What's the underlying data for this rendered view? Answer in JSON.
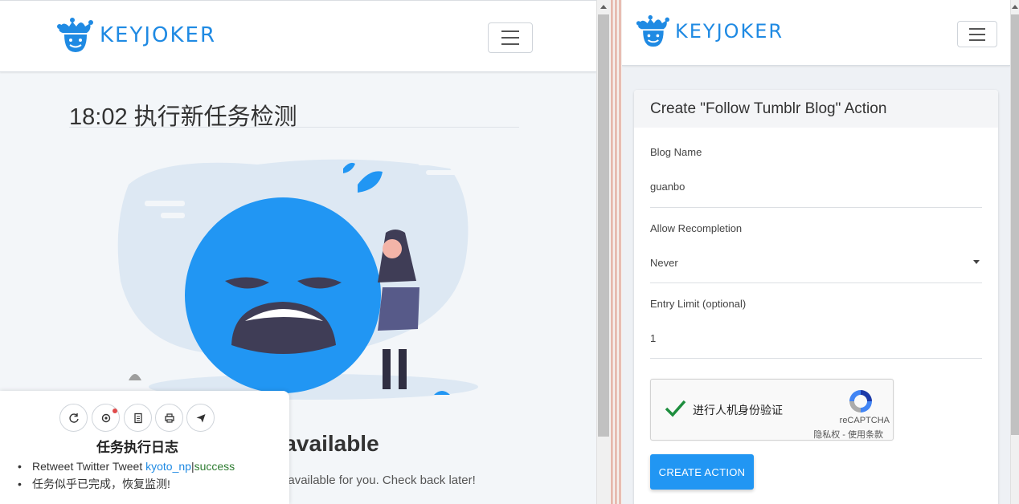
{
  "left_panel": {
    "brand": "KEYJOKER",
    "heading": "18:02 执行新任务检测",
    "empty_title": "s available",
    "empty_subtitle": "ons available for you. Check back later!",
    "task_log": {
      "title": "任务执行日志",
      "toolbar": [
        "refresh-icon",
        "gear-icon",
        "document-icon",
        "printer-icon",
        "send-icon"
      ],
      "entries": [
        {
          "text": "Retweet Twitter Tweet ",
          "link": "kyoto_np",
          "separator": "|",
          "status": "success"
        },
        {
          "text": "任务似乎已完成，恢复监测!"
        }
      ]
    }
  },
  "right_panel": {
    "brand": "KEYJOKER",
    "card_title": "Create \"Follow Tumblr Blog\" Action",
    "fields": {
      "blog_name": {
        "label": "Blog Name",
        "value": "guanbo"
      },
      "allow_recompletion": {
        "label": "Allow Recompletion",
        "value": "Never"
      },
      "entry_limit": {
        "label": "Entry Limit (optional)",
        "value": "1"
      }
    },
    "recaptcha": {
      "label": "进行人机身份验证",
      "brand": "reCAPTCHA",
      "links": "隐私权 - 使用条款"
    },
    "create_button": "CREATE ACTION"
  },
  "colors": {
    "brand_blue": "#1f8ae3",
    "button_blue": "#2196f3",
    "success_green": "#2f7d32",
    "check_green": "#1e8e3e"
  }
}
